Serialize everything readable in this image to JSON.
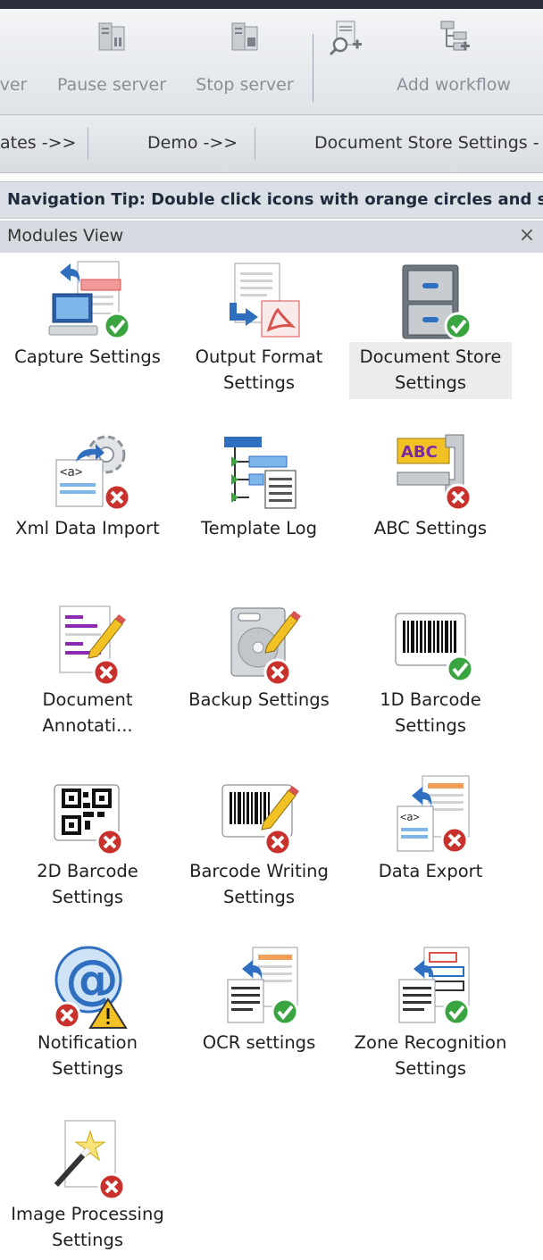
{
  "toolbar": {
    "buttons": [
      {
        "label": "ver"
      },
      {
        "label": "Pause server"
      },
      {
        "label": "Stop server"
      },
      {
        "label": "Add workflow"
      }
    ]
  },
  "tabs": [
    "ates ->>",
    "Demo ->>",
    "Document Store Settings -"
  ],
  "tip": "Navigation Tip: Double click icons with orange circles and si",
  "panel": {
    "title": "Modules View",
    "close": "×"
  },
  "modules": [
    {
      "line1": "Capture Settings",
      "line2": "",
      "icon": "capture-settings-icon",
      "status": "ok"
    },
    {
      "line1": "Output Format",
      "line2": "Settings",
      "icon": "output-format-icon",
      "status": "none"
    },
    {
      "line1": "Document Store",
      "line2": "Settings",
      "icon": "document-store-icon",
      "status": "ok"
    },
    {
      "line1": "Xml Data Import",
      "line2": "",
      "icon": "xml-data-import-icon",
      "status": "error"
    },
    {
      "line1": "Template Log",
      "line2": "",
      "icon": "template-log-icon",
      "status": "none"
    },
    {
      "line1": "ABC Settings",
      "line2": "",
      "icon": "abc-settings-icon",
      "status": "error"
    },
    {
      "line1": "Document",
      "line2": "Annotati...",
      "icon": "document-annotation-icon",
      "status": "error"
    },
    {
      "line1": "Backup Settings",
      "line2": "",
      "icon": "backup-settings-icon",
      "status": "error"
    },
    {
      "line1": "1D Barcode",
      "line2": "Settings",
      "icon": "barcode-1d-icon",
      "status": "ok"
    },
    {
      "line1": "2D Barcode",
      "line2": "Settings",
      "icon": "barcode-2d-icon",
      "status": "error"
    },
    {
      "line1": "Barcode Writing",
      "line2": "Settings",
      "icon": "barcode-writing-icon",
      "status": "error"
    },
    {
      "line1": "Data Export",
      "line2": "",
      "icon": "data-export-icon",
      "status": "error"
    },
    {
      "line1": "Notification",
      "line2": "Settings",
      "icon": "notification-icon",
      "status": "error-warning"
    },
    {
      "line1": "OCR settings",
      "line2": "",
      "icon": "ocr-settings-icon",
      "status": "ok"
    },
    {
      "line1": "Zone Recognition",
      "line2": "Settings",
      "icon": "zone-recognition-icon",
      "status": "ok"
    },
    {
      "line1": "Image Processing",
      "line2": "Settings",
      "icon": "image-processing-icon",
      "status": "error"
    }
  ],
  "colors": {
    "ok": "#3aa540",
    "error": "#c8312c",
    "warning": "#f2c224",
    "accent": "#2f6fc0"
  }
}
